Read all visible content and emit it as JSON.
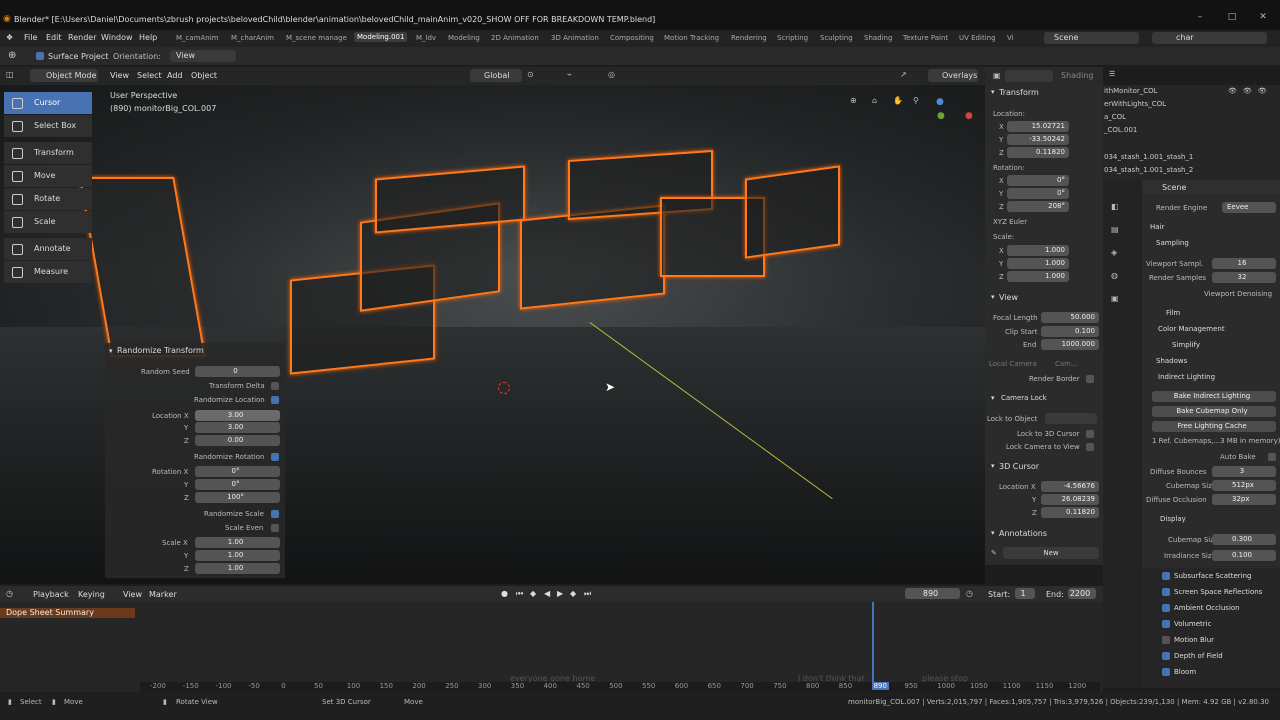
{
  "window": {
    "title": "Blender* [E:\\Users\\Daniel\\Documents\\zbrush projects\\belovedChild\\blender\\animation\\belovedChild_mainAnim_v020_SHOW OFF FOR BREAKDOWN TEMP.blend]",
    "minimize": "–",
    "maximize": "□",
    "close": "✕"
  },
  "menu": {
    "items": [
      "File",
      "Edit",
      "Render",
      "Window",
      "Help"
    ],
    "workspaces": [
      "M_camAnim",
      "M_charAnim",
      "M_scene manage",
      "Modeling.001",
      "M_ldv",
      "Modeling",
      "2D Animation",
      "3D Animation",
      "Compositing",
      "Motion Tracking",
      "Rendering",
      "Scripting",
      "Sculpting",
      "Shading",
      "Texture Paint",
      "UV Editing",
      "Vi"
    ],
    "active_workspace": "Modeling.001",
    "scene_label": "Scene",
    "viewlayer_label": "char"
  },
  "tool_header": {
    "surface_project": "Surface Project",
    "orientation_label": "Orientation:",
    "orientation_value": "View"
  },
  "viewport_header": {
    "mode": "Object Mode",
    "view": "View",
    "select": "Select",
    "add": "Add",
    "object": "Object",
    "transform_orientation": "Global",
    "overlays": "Overlays",
    "shading": "Shading"
  },
  "viewport": {
    "perspective": "User Perspective",
    "object_info": "(890) monitorBig_COL.007"
  },
  "toolbar": [
    {
      "label": "Cursor",
      "selected": true
    },
    {
      "label": "Select Box"
    },
    {
      "label": "Transform"
    },
    {
      "label": "Move"
    },
    {
      "label": "Rotate"
    },
    {
      "label": "Scale"
    },
    {
      "label": "Annotate"
    },
    {
      "label": "Measure"
    }
  ],
  "randomize": {
    "title": "Randomize Transform",
    "random_seed_label": "Random Seed",
    "random_seed": "0",
    "transform_delta": "Transform Delta",
    "randomize_location": "Randomize Location",
    "location_label": "Location X",
    "loc_x": "3.00",
    "loc_y": "3.00",
    "loc_z": "0.00",
    "randomize_rotation": "Randomize Rotation",
    "rotation_label": "Rotation X",
    "rot_x": "0°",
    "rot_y": "0°",
    "rot_z": "100°",
    "randomize_scale": "Randomize Scale",
    "scale_even": "Scale Even",
    "scale_label": "Scale X",
    "scale_x": "1.00",
    "scale_y": "1.00",
    "scale_z": "1.00",
    "y": "Y",
    "z": "Z"
  },
  "npanel": {
    "transform": "Transform",
    "location": "Location:",
    "loc_x": "15.02721",
    "loc_y": "-33.50242",
    "loc_z": "0.11820",
    "rotation": "Rotation:",
    "rot_x": "0°",
    "rot_y": "0°",
    "rot_z": "208°",
    "rot_mode": "XYZ Euler",
    "scale": "Scale:",
    "sc_x": "1.000",
    "sc_y": "1.000",
    "sc_z": "1.000",
    "view": "View",
    "focal_length_label": "Focal Length",
    "focal_length": "50.000",
    "clip_start_label": "Clip Start",
    "clip_start": "0.100",
    "end_label": "End",
    "end": "1000.000",
    "local_camera": "Local Camera",
    "cam_field": "Cam...",
    "render_border": "Render Border",
    "camera_lock": "Camera Lock",
    "lock_to_object": "Lock to Object",
    "lock_to_3d_cursor": "Lock to 3D Cursor",
    "lock_camera_to_view": "Lock Camera to View",
    "cursor": "3D Cursor",
    "cursor_loc_label": "Location X",
    "cursor_x": "-4.56676",
    "cursor_y": "26.08239",
    "cursor_z": "0.11820",
    "annotations": "Annotations",
    "new": "New",
    "x": "X",
    "y": "Y",
    "z": "Z"
  },
  "outliner": {
    "rows": [
      "ithMonitor_COL",
      "erWithLights_COL",
      "a_COL",
      "_COL.001",
      "034_stash_1.001_stash_1",
      "034_stash_1.001_stash_2"
    ],
    "scene": "Scene"
  },
  "properties": {
    "render_engine_label": "Render Engine",
    "render_engine": "Eevee",
    "hair": "Hair",
    "sampling": "Sampling",
    "viewport_samples_label": "Viewport Sampl.",
    "viewport_samples": "16",
    "render_samples_label": "Render Samples",
    "render_samples": "32",
    "viewport_denoising": "Viewport Denoising",
    "film": "Film",
    "color_management": "Color Management",
    "simplify": "Simplify",
    "shadows": "Shadows",
    "indirect_lighting": "Indirect Lighting",
    "bake_indirect": "Bake Indirect Lighting",
    "bake_cubemap": "Bake Cubemap Only",
    "free_cache": "Free Lighting Cache",
    "cache_info": "1 Ref. Cubemaps,...3 MB in memory)",
    "auto_bake": "Auto Bake",
    "diffuse_bounces_label": "Diffuse Bounces",
    "diffuse_bounces": "3",
    "cubemap_size_label": "Cubemap Size",
    "cubemap_size": "512px",
    "diffuse_occlusion_label": "Diffuse Occlusion",
    "diffuse_occlusion": "32px",
    "display": "Display",
    "display_cubemap_label": "Cubemap Size",
    "display_cubemap": "0.300",
    "irradiance_label": "Irradiance Size",
    "irradiance": "0.100",
    "panels": [
      "Subsurface Scattering",
      "Screen Space Reflections",
      "Ambient Occlusion",
      "Volumetric",
      "Motion Blur",
      "Depth of Field",
      "Bloom"
    ]
  },
  "timeline": {
    "playback": "Playback",
    "keying": "Keying",
    "view": "View",
    "marker": "Marker",
    "frame": "890",
    "start_label": "Start:",
    "start": "1",
    "end_label": "End:",
    "end": "2200",
    "summary": "Dope Sheet Summary",
    "ruler": [
      "-200",
      "-150",
      "-100",
      "-50",
      "0",
      "50",
      "100",
      "150",
      "200",
      "250",
      "300",
      "350",
      "400",
      "450",
      "500",
      "550",
      "600",
      "650",
      "700",
      "750",
      "800",
      "850",
      "890",
      "950",
      "1000",
      "1050",
      "1100",
      "1150",
      "1200"
    ],
    "current_frame_marker": "890",
    "marker_a": "everyone gone home",
    "marker_b": "I don't think that",
    "marker_c": "please stop"
  },
  "status": {
    "select": "Select",
    "move": "Move",
    "rotate_view": "Rotate View",
    "set_cursor": "Set 3D Cursor",
    "move2": "Move",
    "stats": "monitorBig_COL.007 | Verts:2,015,797 | Faces:1,905,757 | Tris:3,979,526 | Objects:239/1,130 | Mem: 4.92 GB | v2.80.30"
  },
  "colors": {
    "accent": "#4772b3",
    "selection": "#ff7a1a"
  }
}
